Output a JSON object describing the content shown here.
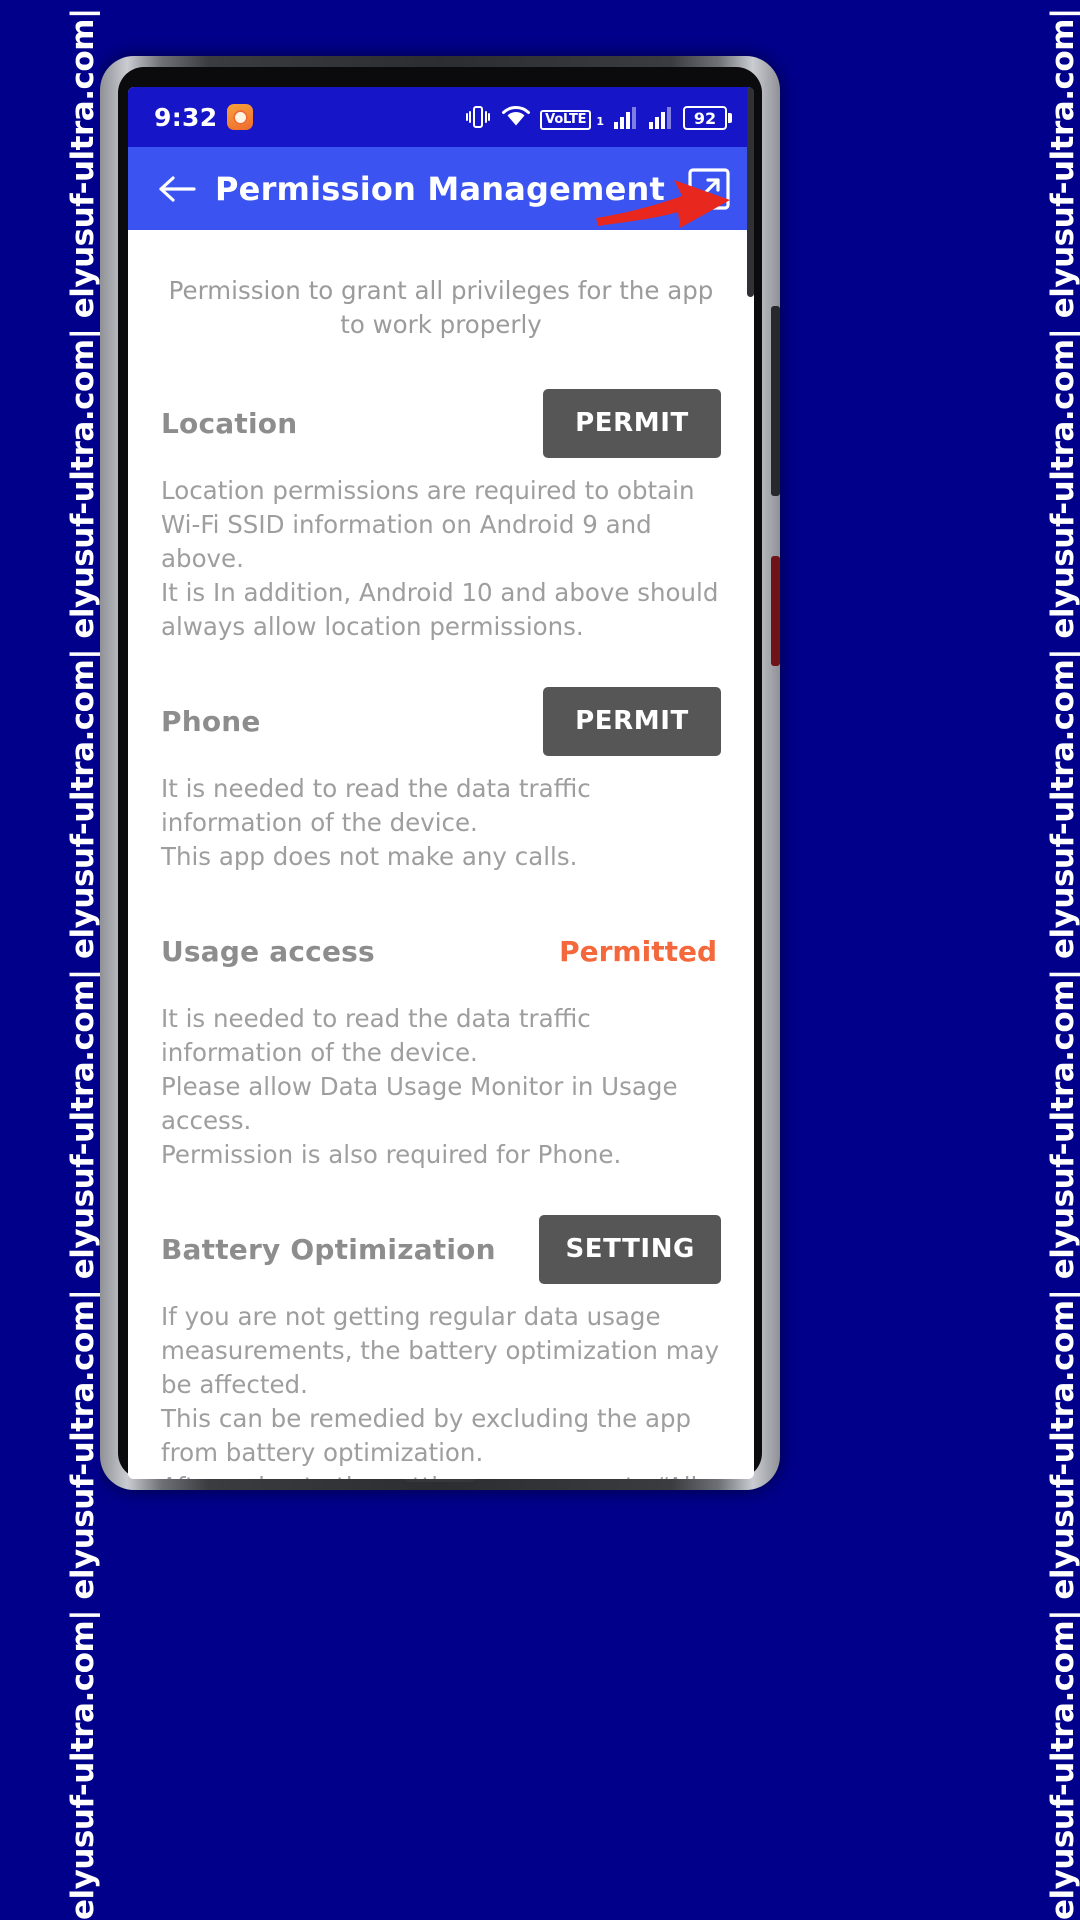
{
  "watermark": {
    "text": "elyusuf-ultra.com| elyusuf-ultra.com| elyusuf-ultra.com| elyusuf-ultra.com| elyusuf-ultra.com| elyusuf-ultra.com| elyusuf-ultra.com| elyusuf-ultra.com| elyusuf-ultra.com| elyusuf-ultra.com| elyusuf-ultra.com|",
    "color": "#ffffff",
    "background": "#00008B"
  },
  "status_bar": {
    "time": "9:32",
    "clock_icon": "alarm-clock-icon",
    "vibrate_icon": "vibrate-icon",
    "wifi_icon": "wifi-icon",
    "volte_label": "VoLTE",
    "volte_sub": "1",
    "signal1_icon": "signal-bars-icon",
    "signal2_icon": "signal-bars-icon",
    "battery_level": "92",
    "background": "#1616C8"
  },
  "app_bar": {
    "back_icon": "back-arrow-icon",
    "title": "Permission Management",
    "share_icon": "open-in-new-icon",
    "background": "#3B53F0",
    "annotation_arrow_color": "#E8281E"
  },
  "content": {
    "intro": "Permission to grant all privileges for the app to work properly",
    "permissions": [
      {
        "name": "Location",
        "action_type": "button",
        "action_label": "PERMIT",
        "description": "Location permissions are required to obtain Wi-Fi SSID information on Android 9 and above.\nIt is In addition, Android 10 and above should always allow location permissions."
      },
      {
        "name": "Phone",
        "action_type": "button",
        "action_label": "PERMIT",
        "description": "It is needed to read the data traffic information of the device.\nThis app does not make any calls."
      },
      {
        "name": "Usage access",
        "action_type": "status",
        "action_label": "Permitted",
        "status_color": "#F4683C",
        "description": "It is needed to read the data traffic information of the device.\nPlease allow Data Usage Monitor in Usage access.\nPermission is also required for Phone."
      },
      {
        "name": "Battery Optimization",
        "action_type": "button",
        "action_label": "SETTING",
        "description": "If you are not getting regular data usage measurements, the battery optimization may be affected.\nThis can be remedied by excluding the app from battery optimization.\nAfter going to the settings screen, go to “All apps” and select “Data Usage Monitor” and set “Don’t optimize” to Setup."
      }
    ],
    "button_color": "#565656",
    "text_color": "#9e9e9e"
  }
}
